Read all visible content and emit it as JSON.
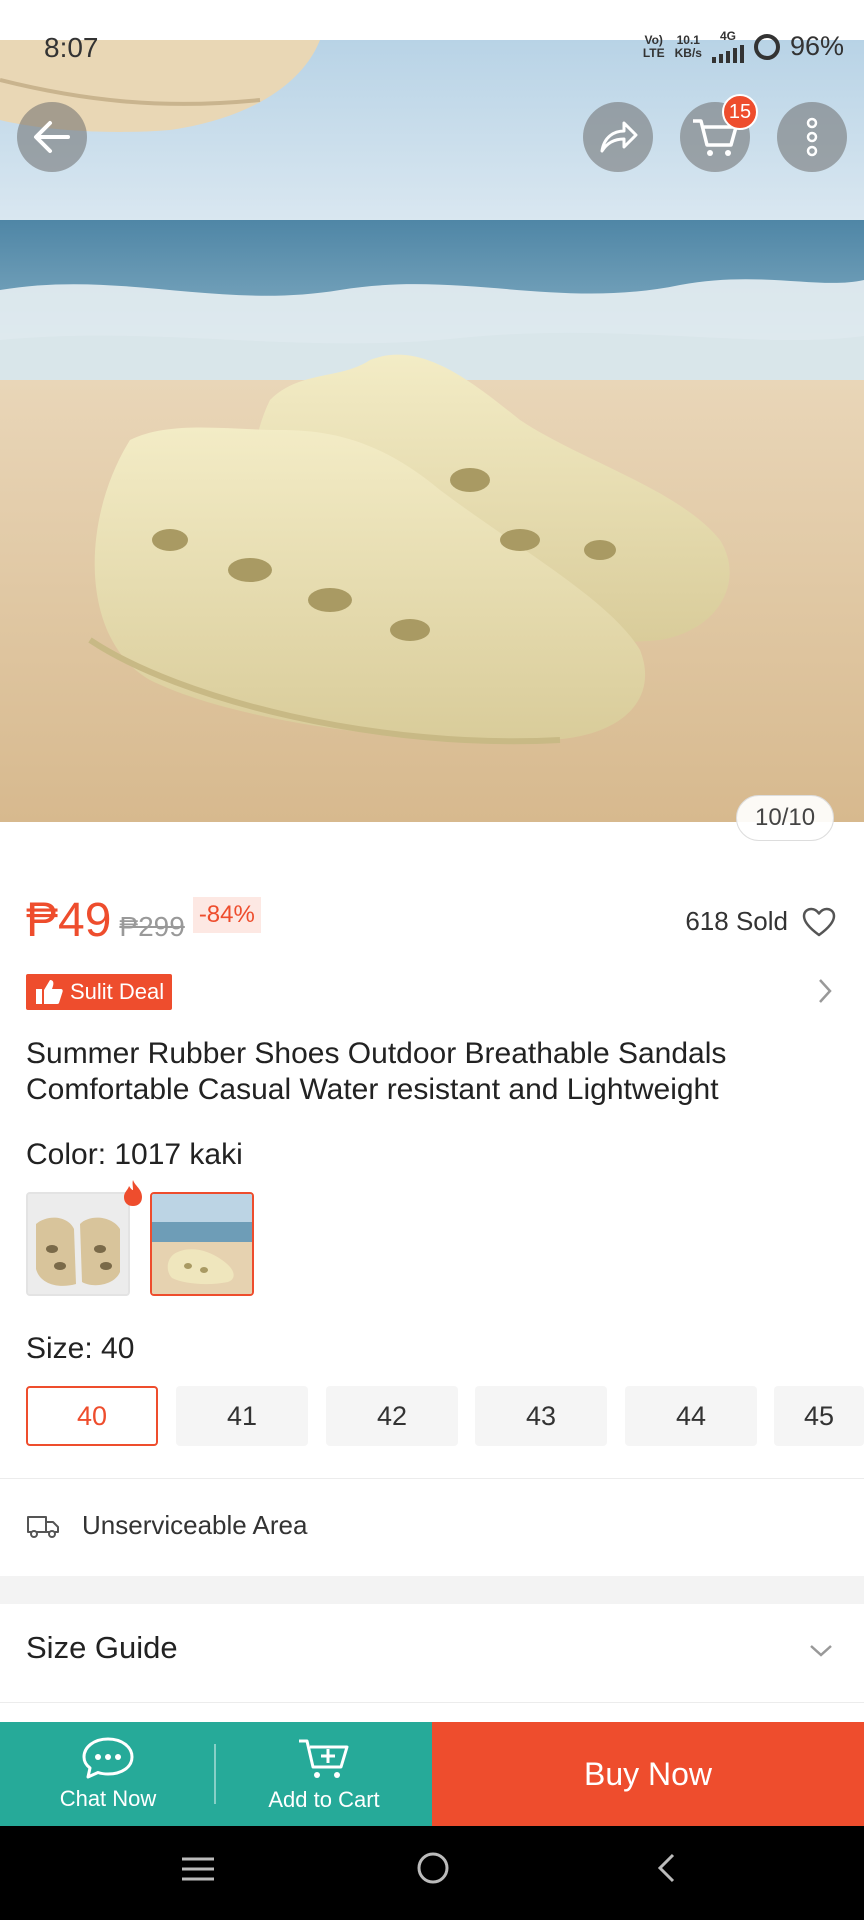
{
  "status_bar": {
    "time": "8:07",
    "volte_top": "Vo)",
    "volte_bottom": "LTE",
    "speed_top": "10.1",
    "speed_bottom": "KB/s",
    "network": "4G",
    "battery": "96%"
  },
  "hero": {
    "cart_count": "15",
    "image_counter": "10/10",
    "icons": [
      "back-arrow-icon",
      "share-icon",
      "cart-icon",
      "more-vertical-icon"
    ]
  },
  "price": {
    "current": "₱49",
    "original": "₱299",
    "discount": "-84%",
    "sold": "618 Sold"
  },
  "deal": {
    "label": "Sulit Deal"
  },
  "product": {
    "title": "Summer Rubber Shoes Outdoor Breathable Sandals Comfortable Casual Water resistant and Lightweight"
  },
  "color": {
    "label": "Color: 1017 kaki",
    "selected_index": 1
  },
  "size": {
    "label": "Size: 40",
    "options": [
      "40",
      "41",
      "42",
      "43",
      "44",
      "45"
    ],
    "selected": "40"
  },
  "shipping": {
    "label": "Unserviceable Area"
  },
  "size_guide": {
    "label": "Size Guide"
  },
  "bottom_bar": {
    "chat_label": "Chat Now",
    "cart_label": "Add to Cart",
    "buy_label": "Buy Now"
  },
  "colors": {
    "accent": "#ee4d2d",
    "teal": "#26aa99"
  }
}
